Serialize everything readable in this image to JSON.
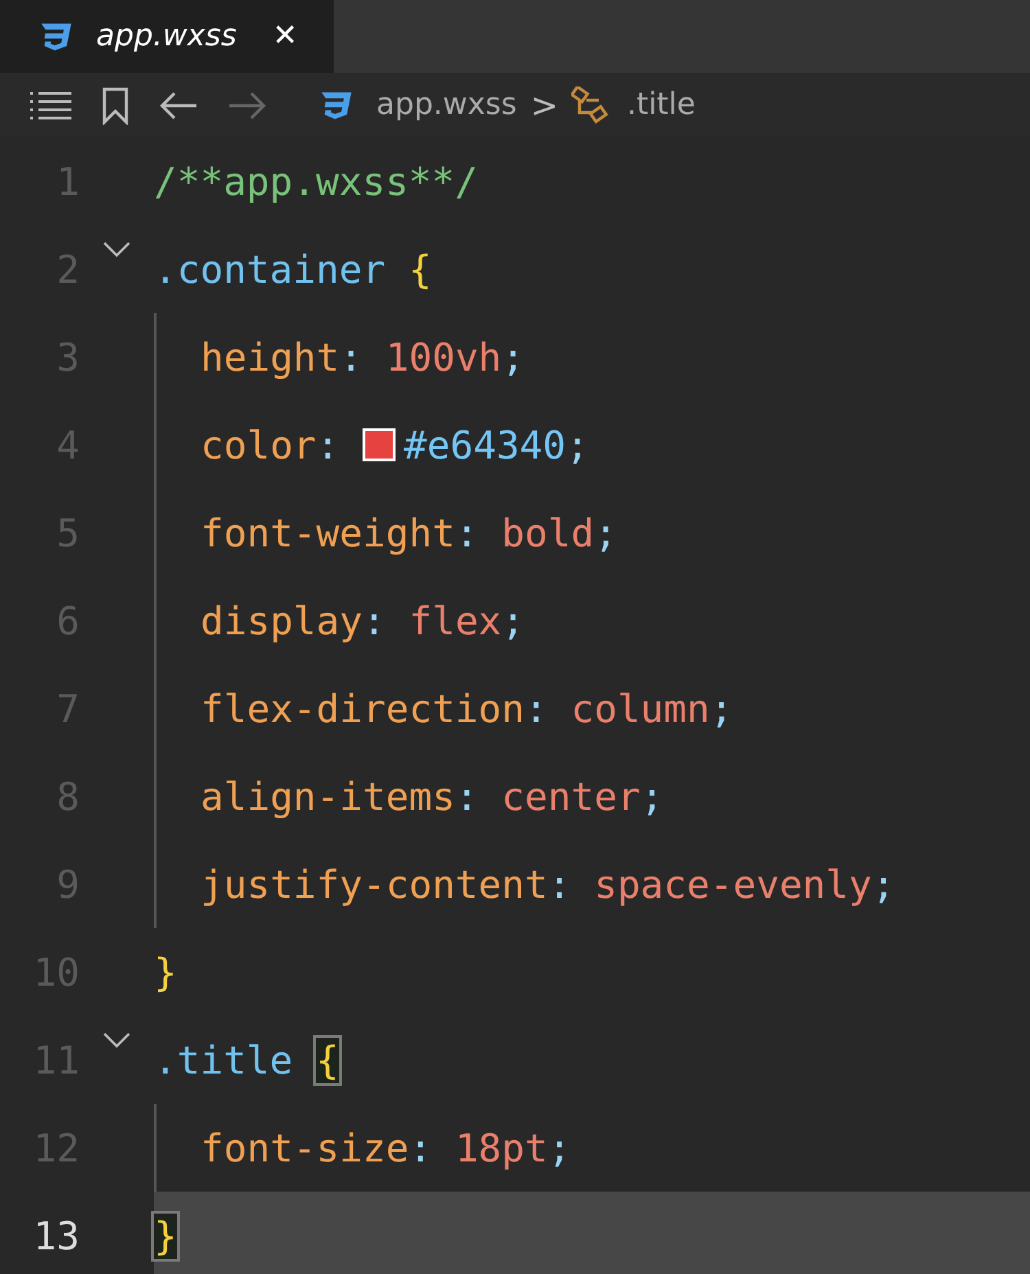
{
  "tab": {
    "title": "app.wxss",
    "close": "✕",
    "selected": true
  },
  "breadcrumb": {
    "file": "app.wxss",
    "separator": ">",
    "symbol": ".title"
  },
  "lines": [
    {
      "number": "1",
      "foldable": false,
      "indented": false,
      "current": false,
      "tokens": [
        {
          "kind": "comment",
          "text": "/**app.wxss**/"
        }
      ]
    },
    {
      "number": "2",
      "foldable": true,
      "indented": false,
      "current": false,
      "tokens": [
        {
          "kind": "selector",
          "text": ".container "
        },
        {
          "kind": "brace",
          "text": "{",
          "matched": false
        }
      ]
    },
    {
      "number": "3",
      "foldable": false,
      "indented": true,
      "current": false,
      "tokens": [
        {
          "kind": "property",
          "text": "height"
        },
        {
          "kind": "punct",
          "text": ": "
        },
        {
          "kind": "value",
          "text": "100vh"
        },
        {
          "kind": "punct",
          "text": ";"
        }
      ]
    },
    {
      "number": "4",
      "foldable": false,
      "indented": true,
      "current": false,
      "tokens": [
        {
          "kind": "property",
          "text": "color"
        },
        {
          "kind": "punct",
          "text": ": "
        },
        {
          "kind": "swatch",
          "color": "#e64340"
        },
        {
          "kind": "hex",
          "text": "#e64340"
        },
        {
          "kind": "punct",
          "text": ";"
        }
      ]
    },
    {
      "number": "5",
      "foldable": false,
      "indented": true,
      "current": false,
      "tokens": [
        {
          "kind": "property",
          "text": "font-weight"
        },
        {
          "kind": "punct",
          "text": ": "
        },
        {
          "kind": "value",
          "text": "bold"
        },
        {
          "kind": "punct",
          "text": ";"
        }
      ]
    },
    {
      "number": "6",
      "foldable": false,
      "indented": true,
      "current": false,
      "tokens": [
        {
          "kind": "property",
          "text": "display"
        },
        {
          "kind": "punct",
          "text": ": "
        },
        {
          "kind": "value",
          "text": "flex"
        },
        {
          "kind": "punct",
          "text": ";"
        }
      ]
    },
    {
      "number": "7",
      "foldable": false,
      "indented": true,
      "current": false,
      "tokens": [
        {
          "kind": "property",
          "text": "flex-direction"
        },
        {
          "kind": "punct",
          "text": ": "
        },
        {
          "kind": "value",
          "text": "column"
        },
        {
          "kind": "punct",
          "text": ";"
        }
      ]
    },
    {
      "number": "8",
      "foldable": false,
      "indented": true,
      "current": false,
      "tokens": [
        {
          "kind": "property",
          "text": "align-items"
        },
        {
          "kind": "punct",
          "text": ": "
        },
        {
          "kind": "value",
          "text": "center"
        },
        {
          "kind": "punct",
          "text": ";"
        }
      ]
    },
    {
      "number": "9",
      "foldable": false,
      "indented": true,
      "current": false,
      "tokens": [
        {
          "kind": "property",
          "text": "justify-content"
        },
        {
          "kind": "punct",
          "text": ": "
        },
        {
          "kind": "value",
          "text": "space-evenly"
        },
        {
          "kind": "punct",
          "text": ";"
        }
      ]
    },
    {
      "number": "10",
      "foldable": false,
      "indented": false,
      "current": false,
      "tokens": [
        {
          "kind": "brace",
          "text": "}",
          "matched": false
        }
      ]
    },
    {
      "number": "11",
      "foldable": true,
      "indented": false,
      "current": false,
      "tokens": [
        {
          "kind": "selector",
          "text": ".title "
        },
        {
          "kind": "brace",
          "text": "{",
          "matched": true
        }
      ]
    },
    {
      "number": "12",
      "foldable": false,
      "indented": true,
      "current": false,
      "tokens": [
        {
          "kind": "property",
          "text": "font-size"
        },
        {
          "kind": "punct",
          "text": ": "
        },
        {
          "kind": "value",
          "text": "18pt"
        },
        {
          "kind": "punct",
          "text": ";"
        }
      ]
    },
    {
      "number": "13",
      "foldable": false,
      "indented": false,
      "current": true,
      "tokens": [
        {
          "kind": "brace",
          "text": "}",
          "matched": true
        }
      ]
    }
  ]
}
